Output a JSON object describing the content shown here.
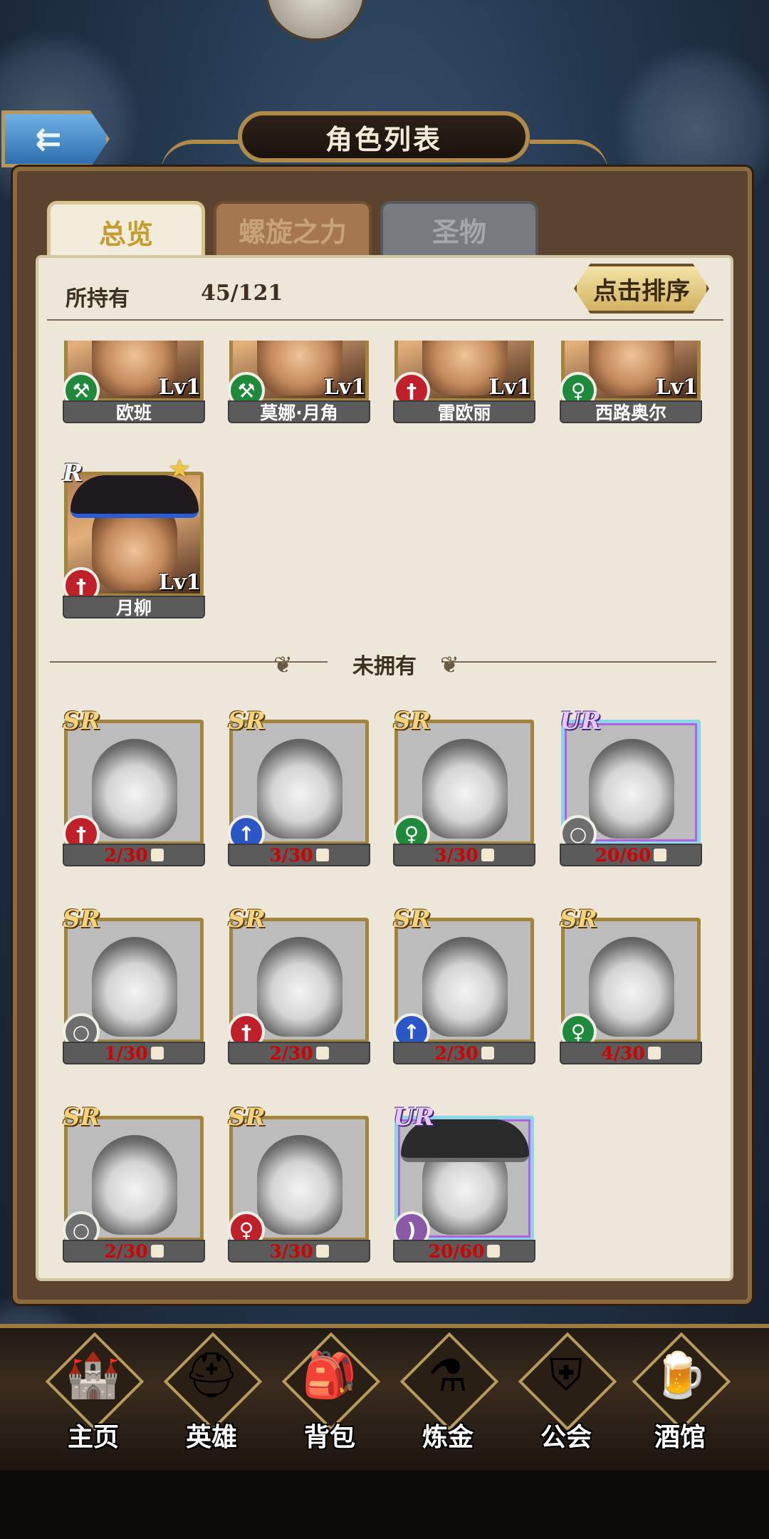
{
  "header": {
    "title": "角色列表",
    "back_label": "⇇"
  },
  "tabs": [
    {
      "label": "总览",
      "state": "active"
    },
    {
      "label": "螺旋之力",
      "state": "inactive"
    },
    {
      "label": "圣物",
      "state": "disabled"
    }
  ],
  "owned": {
    "label": "所持有",
    "count": "45/121"
  },
  "sort_button": "点击排序",
  "owned_cards": [
    {
      "name": "欧班",
      "level": "Lv1",
      "class_color": "green",
      "class_icon": "axe-icon",
      "rarity": ""
    },
    {
      "name": "莫娜·月角",
      "level": "Lv1",
      "class_color": "green",
      "class_icon": "axe-icon",
      "rarity": ""
    },
    {
      "name": "雷欧丽",
      "level": "Lv1",
      "class_color": "red",
      "class_icon": "sword-icon",
      "rarity": ""
    },
    {
      "name": "西路奥尔",
      "level": "Lv1",
      "class_color": "green",
      "class_icon": "staff-icon",
      "rarity": ""
    },
    {
      "name": "月柳",
      "level": "Lv1",
      "class_color": "red",
      "class_icon": "sword-icon",
      "rarity": "R"
    }
  ],
  "unowned_label": "未拥有",
  "unowned_cards": [
    {
      "rarity": "SR",
      "fragments": "2/30",
      "class_color": "red",
      "class_icon": "sword-icon"
    },
    {
      "rarity": "SR",
      "fragments": "3/30",
      "class_color": "blue",
      "class_icon": "spear-icon"
    },
    {
      "rarity": "SR",
      "fragments": "3/30",
      "class_color": "green",
      "class_icon": "staff-icon"
    },
    {
      "rarity": "UR",
      "fragments": "20/60",
      "class_color": "purple",
      "class_icon": "wand-icon"
    },
    {
      "rarity": "SR",
      "fragments": "1/30",
      "class_color": "gray",
      "class_icon": "wand-icon"
    },
    {
      "rarity": "SR",
      "fragments": "2/30",
      "class_color": "red",
      "class_icon": "sword-icon"
    },
    {
      "rarity": "SR",
      "fragments": "2/30",
      "class_color": "blue",
      "class_icon": "spear-icon"
    },
    {
      "rarity": "SR",
      "fragments": "4/30",
      "class_color": "green",
      "class_icon": "staff-icon"
    },
    {
      "rarity": "SR",
      "fragments": "2/30",
      "class_color": "gray",
      "class_icon": "wand-icon"
    },
    {
      "rarity": "SR",
      "fragments": "3/30",
      "class_color": "red",
      "class_icon": "staff-icon"
    },
    {
      "rarity": "UR",
      "fragments": "20/60",
      "class_color": "purple",
      "class_icon": "bow-icon"
    }
  ],
  "nav": [
    {
      "label": "主页",
      "icon": "castle-icon"
    },
    {
      "label": "英雄",
      "icon": "helmet-icon"
    },
    {
      "label": "背包",
      "icon": "backpack-icon"
    },
    {
      "label": "炼金",
      "icon": "flask-icon"
    },
    {
      "label": "公会",
      "icon": "shield-icon"
    },
    {
      "label": "酒馆",
      "icon": "beer-mug-icon"
    }
  ],
  "colors": {
    "panel": "#ece7d9",
    "frame": "#5b4330",
    "gold": "#b08a4a",
    "fragment_red": "#d40000"
  }
}
